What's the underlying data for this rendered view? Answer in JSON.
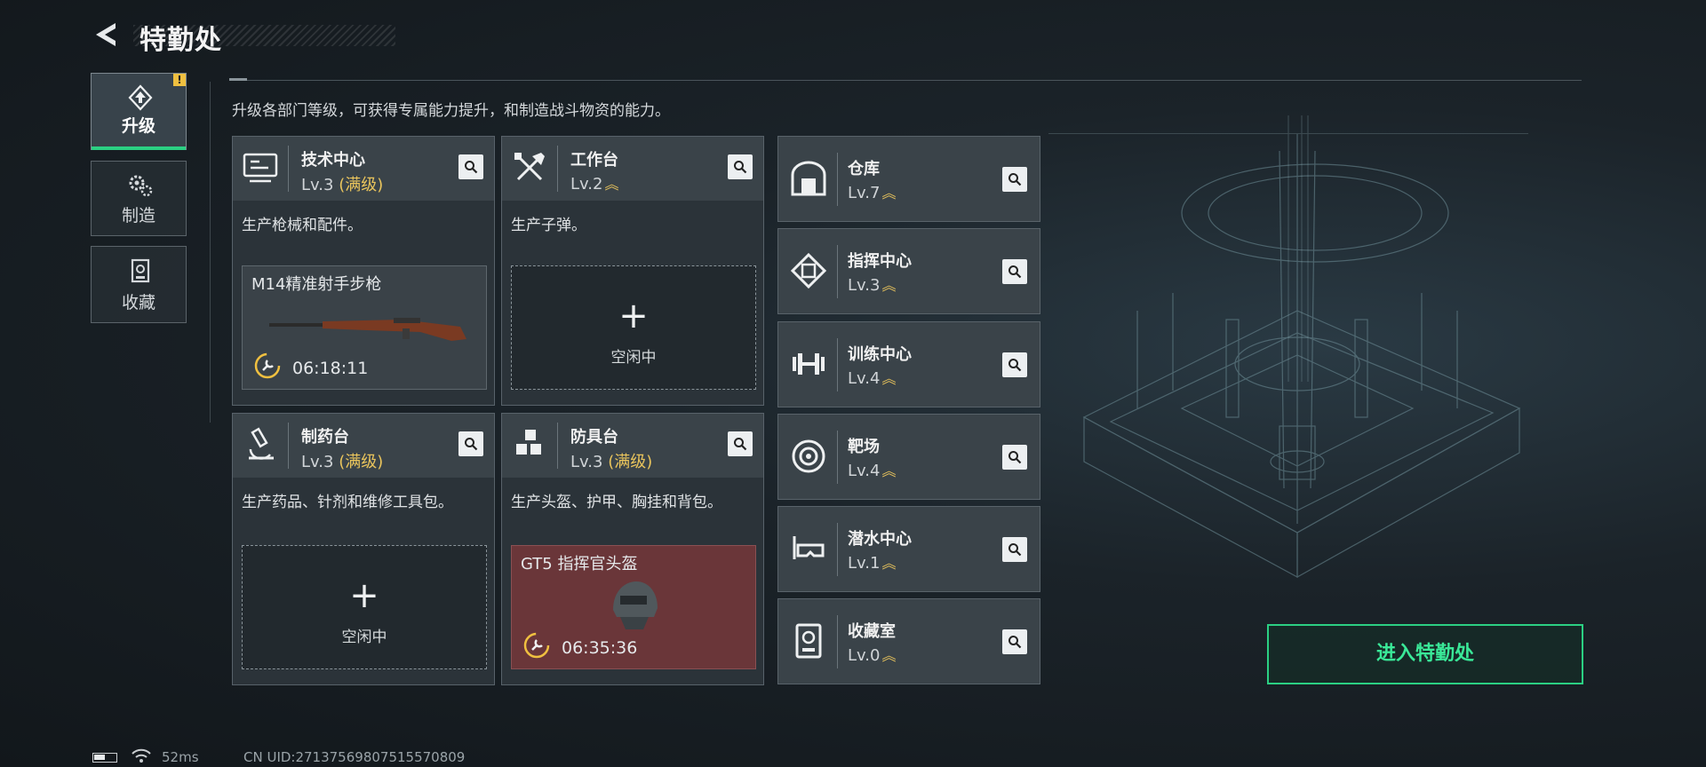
{
  "header": {
    "title": "特勤处",
    "description": "升级各部门等级，可获得专属能力提升，和制造战斗物资的能力。"
  },
  "side_tabs": [
    {
      "label": "升级",
      "icon": "upgrade-icon",
      "active": true,
      "badge": "!"
    },
    {
      "label": "制造",
      "icon": "craft-gears-icon",
      "active": false
    },
    {
      "label": "收藏",
      "icon": "collection-icon",
      "active": false
    }
  ],
  "departments": [
    {
      "name": "技术中心",
      "level": "Lv.3",
      "max_tag": "(满级)",
      "icon": "monitor-icon",
      "desc": "生产枪械和配件。",
      "slot": {
        "state": "producing",
        "item": "M14精准射手步枪",
        "timer": "06:18:11"
      }
    },
    {
      "name": "工作台",
      "level": "Lv.2",
      "icon": "tools-icon",
      "desc": "生产子弹。",
      "slot": {
        "state": "idle",
        "label": "空闲中"
      }
    },
    {
      "name": "制药台",
      "level": "Lv.3",
      "max_tag": "(满级)",
      "icon": "microscope-icon",
      "desc": "生产药品、针剂和维修工具包。",
      "slot": {
        "state": "idle",
        "label": "空闲中"
      }
    },
    {
      "name": "防具台",
      "level": "Lv.3",
      "max_tag": "(满级)",
      "icon": "armor-cubes-icon",
      "desc": "生产头盔、护甲、胸挂和背包。",
      "slot": {
        "state": "producing",
        "item": "GT5 指挥官头盔",
        "timer": "06:35:36"
      }
    }
  ],
  "facilities": [
    {
      "name": "仓库",
      "level": "Lv.7",
      "icon": "warehouse-icon"
    },
    {
      "name": "指挥中心",
      "level": "Lv.3",
      "icon": "command-chip-icon"
    },
    {
      "name": "训练中心",
      "level": "Lv.4",
      "icon": "dumbbell-icon"
    },
    {
      "name": "靶场",
      "level": "Lv.4",
      "icon": "target-icon"
    },
    {
      "name": "潜水中心",
      "level": "Lv.1",
      "icon": "diving-mask-icon"
    },
    {
      "name": "收藏室",
      "level": "Lv.0",
      "icon": "vault-icon"
    }
  ],
  "enter_button": "进入特勤处",
  "status_bar": {
    "ping": "52ms",
    "uid": "CN UID:27137569807515570809"
  },
  "colors": {
    "accent_green": "#2bd083",
    "gold": "#e9c45c",
    "item_red": "#6a3639"
  }
}
